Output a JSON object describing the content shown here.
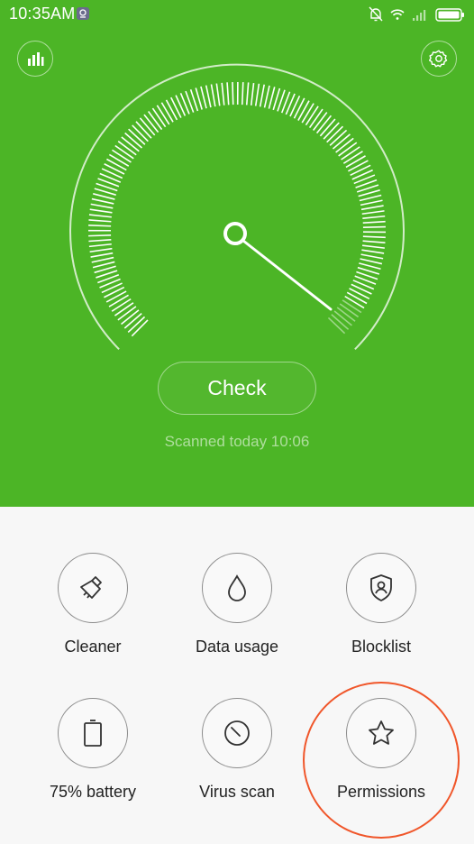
{
  "status_bar": {
    "time": "10:35AM",
    "icons": [
      "app-notification-icon",
      "muted-bell-icon",
      "wifi-icon",
      "signal-icon",
      "battery-icon"
    ]
  },
  "header": {
    "left_icon": "bar-chart-icon",
    "right_icon": "gear-icon"
  },
  "scan": {
    "check_label": "Check",
    "last_scanned": "Scanned today 10:06"
  },
  "tools": [
    {
      "label": "Cleaner",
      "icon": "broom-icon"
    },
    {
      "label": "Data usage",
      "icon": "droplet-icon"
    },
    {
      "label": "Blocklist",
      "icon": "shield-user-icon"
    },
    {
      "label": "75% battery",
      "icon": "battery-icon"
    },
    {
      "label": "Virus scan",
      "icon": "scan-dial-icon"
    },
    {
      "label": "Permissions",
      "icon": "star-icon"
    }
  ],
  "colors": {
    "hero_green": "#4cb526",
    "highlight": "#f0562a",
    "panel_bg": "#f7f7f7"
  }
}
